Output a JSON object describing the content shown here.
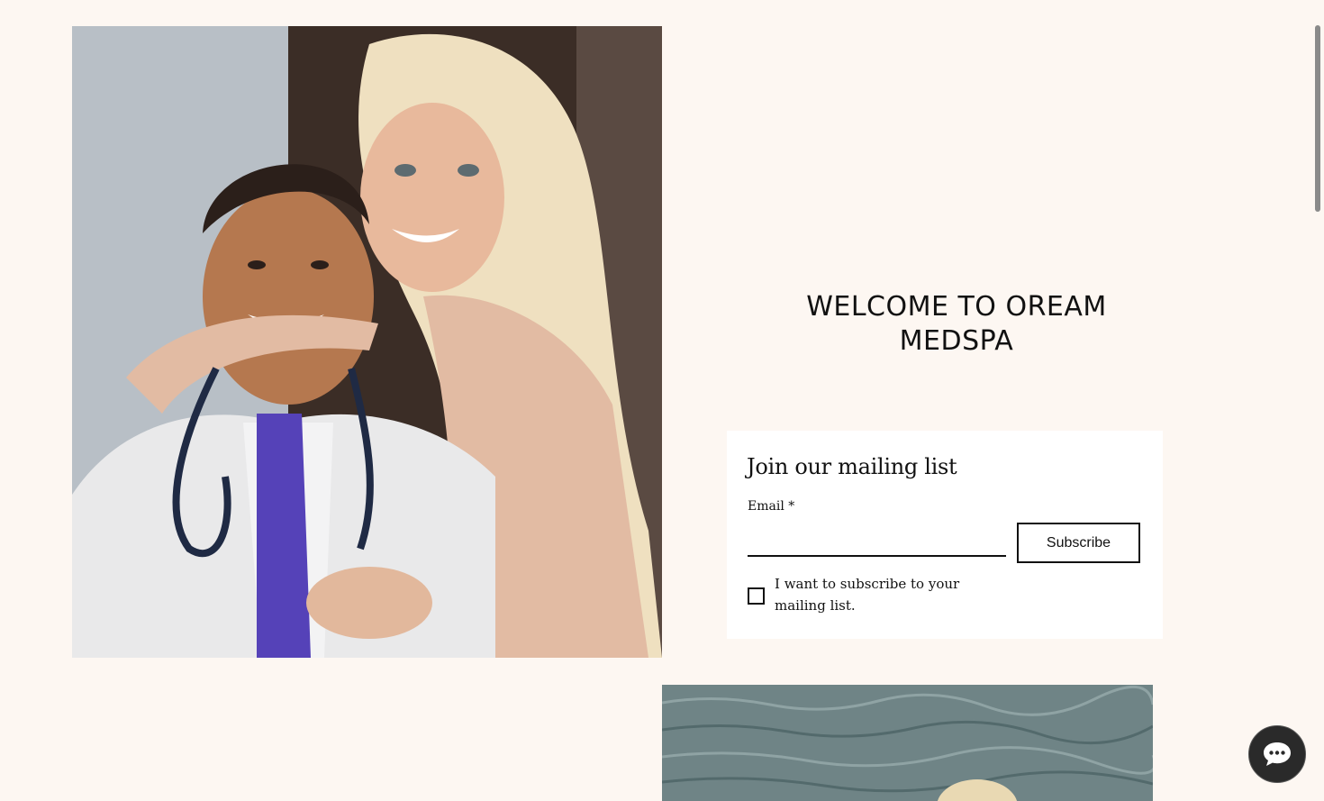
{
  "hero": {
    "image_alt": "Smiling doctor in white coat with stethoscope and blonde woman embracing him"
  },
  "welcome": {
    "heading": "WELCOME TO OREAM MEDSPA"
  },
  "mailing": {
    "title": "Join our mailing list",
    "email_label": "Email *",
    "email_value": "",
    "subscribe_label": "Subscribe",
    "consent_label": "I want to subscribe to your mailing list.",
    "consent_checked": false
  },
  "second_photo": {
    "image_alt": "Ocean water with blonde hair visible at bottom"
  },
  "chat": {
    "icon": "chat-bubble-icon"
  },
  "colors": {
    "page_background": "#fdf7f2",
    "card_background": "#ffffff",
    "text": "#111111",
    "chat_button": "#2a2a2a"
  }
}
